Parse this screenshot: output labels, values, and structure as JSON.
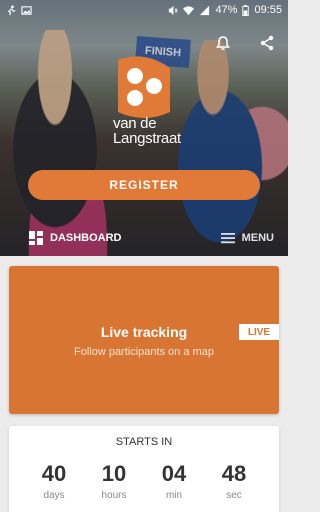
{
  "status": {
    "battery": "47%",
    "time": "09:55"
  },
  "hero": {
    "brand_line1": "van de",
    "brand_line2": "Langstraat",
    "sign_text": "FINISH",
    "register_label": "REGISTER"
  },
  "nav": {
    "dashboard_label": "DASHBOARD",
    "menu_label": "MENU"
  },
  "tracking": {
    "title": "Live tracking",
    "subtitle": "Follow participants on a map",
    "badge": "LIVE"
  },
  "countdown": {
    "label": "STARTS IN",
    "items": [
      {
        "value": "40",
        "unit": "days"
      },
      {
        "value": "10",
        "unit": "hours"
      },
      {
        "value": "04",
        "unit": "min"
      },
      {
        "value": "48",
        "unit": "sec"
      }
    ]
  },
  "colors": {
    "accent": "#e07a36",
    "card": "#d97533"
  }
}
